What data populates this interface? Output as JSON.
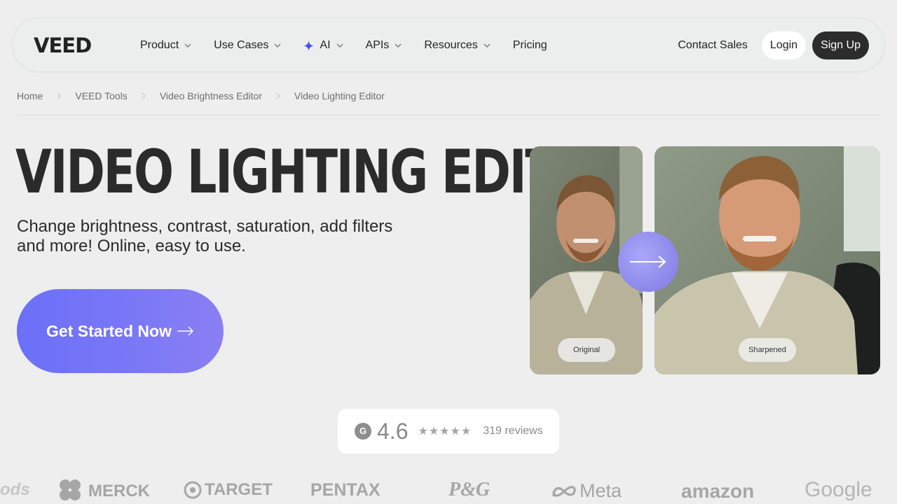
{
  "nav": {
    "logo": "VEED",
    "items": [
      {
        "label": "Product",
        "has_dropdown": true
      },
      {
        "label": "Use Cases",
        "has_dropdown": true
      },
      {
        "label": "AI",
        "has_dropdown": true,
        "icon": "sparkle-icon"
      },
      {
        "label": "APIs",
        "has_dropdown": true
      },
      {
        "label": "Resources",
        "has_dropdown": true
      },
      {
        "label": "Pricing",
        "has_dropdown": false
      }
    ],
    "contact": "Contact Sales",
    "login": "Login",
    "signup": "Sign Up"
  },
  "breadcrumb": [
    "Home",
    "VEED Tools",
    "Video Brightness Editor",
    "Video Lighting Editor"
  ],
  "hero": {
    "title": "VIDEO LIGHTING EDITOR",
    "subtitle_line1": "Change brightness, contrast, saturation, add filters",
    "subtitle_line2": "and more! Online, easy to use.",
    "cta": "Get Started Now"
  },
  "compare": {
    "left_label": "Original",
    "right_label": "Sharpened"
  },
  "rating": {
    "score": "4.6",
    "stars": "★★★★★",
    "reviews": "319 reviews"
  },
  "logos": [
    "ods",
    "MERCK",
    "TARGET",
    "PENTAX",
    "P&G",
    "Meta",
    "amazon",
    "Google"
  ],
  "colors": {
    "background": "#edeeed",
    "cta_start": "#6b6ff8",
    "cta_end": "#8a7ff3",
    "signup_bg": "#2c2c2c",
    "ai_sparkle": "#4a4cf0"
  }
}
